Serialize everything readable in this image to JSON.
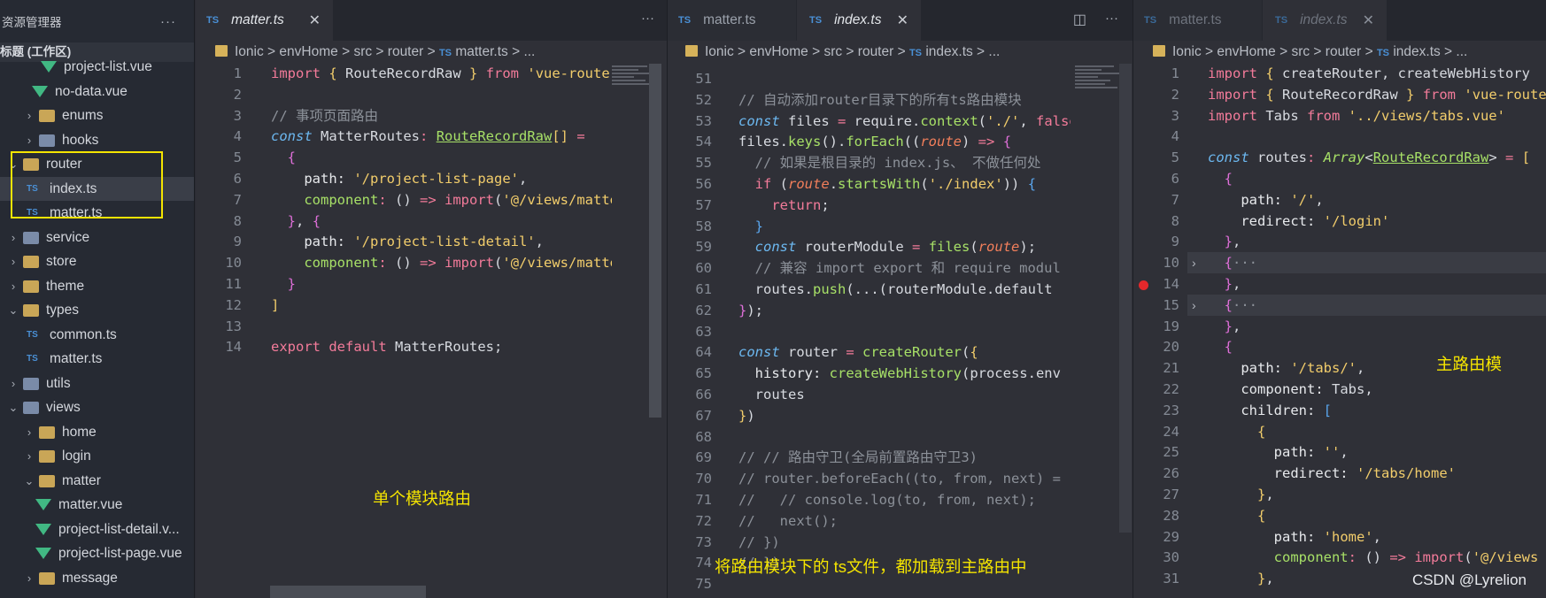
{
  "sidebar": {
    "title": "资源管理器",
    "more": "···",
    "project": "标题 (工作区)",
    "items": [
      {
        "label": "project-list.vue",
        "type": "vue"
      },
      {
        "label": "no-data.vue",
        "type": "vue"
      },
      {
        "label": "enums",
        "type": "folder"
      },
      {
        "label": "hooks",
        "type": "folder"
      },
      {
        "label": "router",
        "type": "folder-open"
      },
      {
        "label": "index.ts",
        "type": "ts"
      },
      {
        "label": "matter.ts",
        "type": "ts"
      },
      {
        "label": "service",
        "type": "folder"
      },
      {
        "label": "store",
        "type": "folder"
      },
      {
        "label": "theme",
        "type": "folder"
      },
      {
        "label": "types",
        "type": "folder-open"
      },
      {
        "label": "common.ts",
        "type": "ts"
      },
      {
        "label": "matter.ts",
        "type": "ts"
      },
      {
        "label": "utils",
        "type": "folder"
      },
      {
        "label": "views",
        "type": "folder-open"
      },
      {
        "label": "home",
        "type": "folder"
      },
      {
        "label": "login",
        "type": "folder"
      },
      {
        "label": "matter",
        "type": "folder-open"
      },
      {
        "label": "matter.vue",
        "type": "vue"
      },
      {
        "label": "project-list-detail.v...",
        "type": "vue"
      },
      {
        "label": "project-list-page.vue",
        "type": "vue"
      },
      {
        "label": "message",
        "type": "folder"
      }
    ]
  },
  "pane1": {
    "tab": "matter.ts",
    "tab_badge": "TS",
    "breadcrumb": [
      "Ionic",
      "envHome",
      "src",
      "router",
      "matter.ts",
      "..."
    ],
    "annotation": "单个模块路由"
  },
  "pane2": {
    "tabs": [
      "matter.ts",
      "index.ts"
    ],
    "breadcrumb": [
      "Ionic",
      "envHome",
      "src",
      "router",
      "index.ts",
      "..."
    ],
    "annotation": "将路由模块下的 ts文件，都加载到主路由中"
  },
  "pane3": {
    "tabs": [
      "matter.ts",
      "index.ts"
    ],
    "breadcrumb": [
      "Ionic",
      "envHome",
      "src",
      "router",
      "index.ts",
      "..."
    ],
    "annotation": "主路由模"
  },
  "watermark": "CSDN @Lyrelion",
  "colors": {
    "highlight_box": "#f4e400",
    "breakpoint": "#e5282b"
  }
}
